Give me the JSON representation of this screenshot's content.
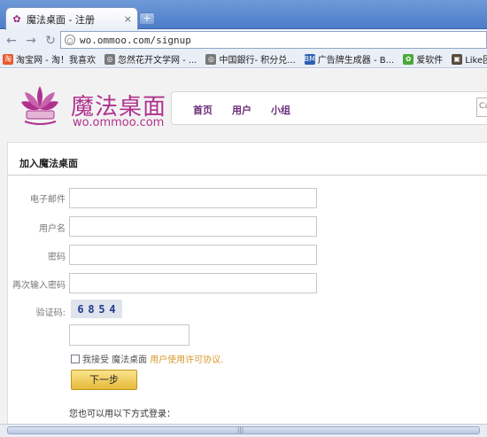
{
  "browser": {
    "tab_title": "魔法桌面 - 注册",
    "tab_close": "×",
    "new_tab": "+",
    "url": "wo.ommoo.com/signup",
    "bookmarks": [
      {
        "label": "淘宝网 - 淘！我喜欢",
        "icon": "taobao-icon",
        "color": "#e8592a",
        "glyph": "淘"
      },
      {
        "label": "忽然花开文学网 - ...",
        "icon": "globe-icon",
        "color": "#777777",
        "glyph": "◎"
      },
      {
        "label": "中国銀行- 积分兑...",
        "icon": "globe-icon",
        "color": "#777777",
        "glyph": "◎"
      },
      {
        "label": "广告牌生成器 - B...",
        "icon": "bm-icon",
        "color": "#2d5fb3",
        "glyph": "BM"
      },
      {
        "label": "爱软件",
        "icon": "leaf-icon",
        "color": "#4aa83a",
        "glyph": "✿"
      },
      {
        "label": "Like团",
        "icon": "photo-icon",
        "color": "#5a4a3a",
        "glyph": "▣"
      }
    ]
  },
  "site": {
    "logo_text": "魔法桌面",
    "logo_url": "wo.ommoo.com",
    "nav": [
      "首页",
      "用户",
      "小组"
    ],
    "search_stub": "Ca"
  },
  "form": {
    "title": "加入魔法桌面",
    "fields": [
      {
        "label": "电子邮件",
        "value": ""
      },
      {
        "label": "用户名",
        "value": ""
      },
      {
        "label": "密码",
        "value": ""
      },
      {
        "label": "再次输入密码",
        "value": ""
      }
    ],
    "captcha_label": "验证码:",
    "captcha_digits": [
      "6",
      "8",
      "5",
      "4"
    ],
    "agree_prefix": "我接受 魔法桌面",
    "agree_link": "用户使用许可协议.",
    "next_button": "下一步",
    "alt_login": "您也可以用以下方式登录："
  },
  "colors": {
    "brand": "#b0328f",
    "nav_link": "#6b2c7a",
    "button": "#e6b93a",
    "link": "#d89a2e"
  }
}
